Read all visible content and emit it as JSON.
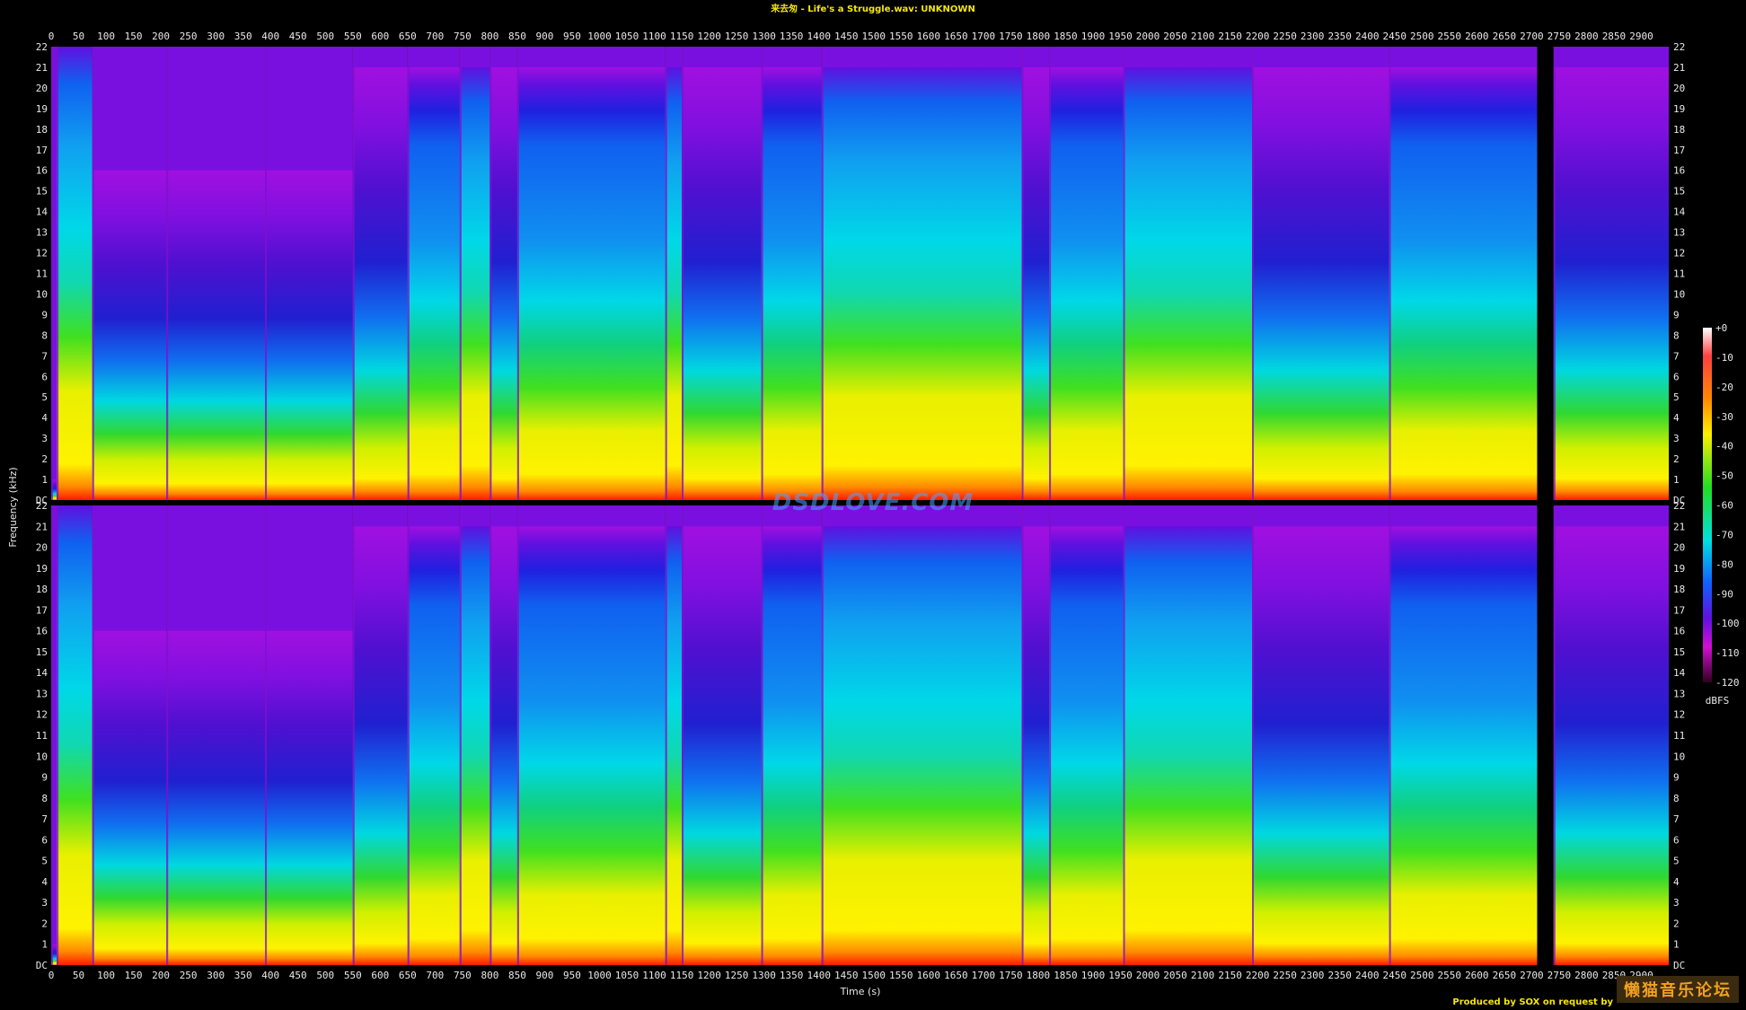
{
  "title": "来去匆 - Life's a Struggle.wav: UNKNOWN",
  "credit": "Produced by SOX on request by",
  "watermark": "DSDLOVE.COM",
  "logo_text": "懒猫音乐论坛",
  "chart_data": {
    "type": "heatmap",
    "title": "来去匆 - Life's a Struggle.wav: UNKNOWN",
    "xlabel": "Time (s)",
    "ylabel": "Frequency (kHz)",
    "channels": 2,
    "x_ticks": [
      0,
      50,
      100,
      150,
      200,
      250,
      300,
      350,
      400,
      450,
      500,
      550,
      600,
      650,
      700,
      750,
      800,
      850,
      900,
      950,
      1000,
      1050,
      1100,
      1150,
      1200,
      1250,
      1300,
      1350,
      1400,
      1450,
      1500,
      1550,
      1600,
      1650,
      1700,
      1750,
      1800,
      1850,
      1900,
      1950,
      2000,
      2050,
      2100,
      2150,
      2200,
      2250,
      2300,
      2350,
      2400,
      2450,
      2500,
      2550,
      2600,
      2650,
      2700,
      2750,
      2800,
      2850,
      2900
    ],
    "x_range": [
      0,
      2950
    ],
    "y_ticks": [
      "DC",
      "1",
      "2",
      "3",
      "4",
      "5",
      "6",
      "7",
      "8",
      "9",
      "10",
      "11",
      "12",
      "13",
      "14",
      "15",
      "16",
      "17",
      "18",
      "19",
      "20",
      "21",
      "22"
    ],
    "y_range_khz": [
      0,
      22
    ],
    "colorbar": {
      "label": "dBFS",
      "ticks": [
        "+0",
        "-10",
        "-20",
        "-30",
        "-40",
        "-50",
        "-60",
        "-70",
        "-80",
        "-90",
        "-100",
        "-110",
        "-120"
      ],
      "range": [
        -120,
        0
      ]
    },
    "tracks": [
      {
        "start": 0,
        "end": 10,
        "bw_khz": 1
      },
      {
        "start": 10,
        "end": 75,
        "bw_khz": 22
      },
      {
        "start": 75,
        "end": 210,
        "bw_khz": 16
      },
      {
        "start": 210,
        "end": 390,
        "bw_khz": 16
      },
      {
        "start": 390,
        "end": 550,
        "bw_khz": 16
      },
      {
        "start": 550,
        "end": 650,
        "bw_khz": 21
      },
      {
        "start": 650,
        "end": 745,
        "bw_khz": 21
      },
      {
        "start": 745,
        "end": 800,
        "bw_khz": 21
      },
      {
        "start": 800,
        "end": 850,
        "bw_khz": 21
      },
      {
        "start": 850,
        "end": 1120,
        "bw_khz": 21
      },
      {
        "start": 1120,
        "end": 1150,
        "bw_khz": 21
      },
      {
        "start": 1150,
        "end": 1295,
        "bw_khz": 21
      },
      {
        "start": 1295,
        "end": 1405,
        "bw_khz": 21
      },
      {
        "start": 1405,
        "end": 1770,
        "bw_khz": 21
      },
      {
        "start": 1770,
        "end": 1820,
        "bw_khz": 21
      },
      {
        "start": 1820,
        "end": 1955,
        "bw_khz": 21
      },
      {
        "start": 1955,
        "end": 2190,
        "bw_khz": 21
      },
      {
        "start": 2190,
        "end": 2440,
        "bw_khz": 21
      },
      {
        "start": 2440,
        "end": 2710,
        "bw_khz": 21
      },
      {
        "start": 2710,
        "end": 2740,
        "bw_khz": 0
      },
      {
        "start": 2740,
        "end": 2950,
        "bw_khz": 21
      }
    ],
    "grid": false
  }
}
